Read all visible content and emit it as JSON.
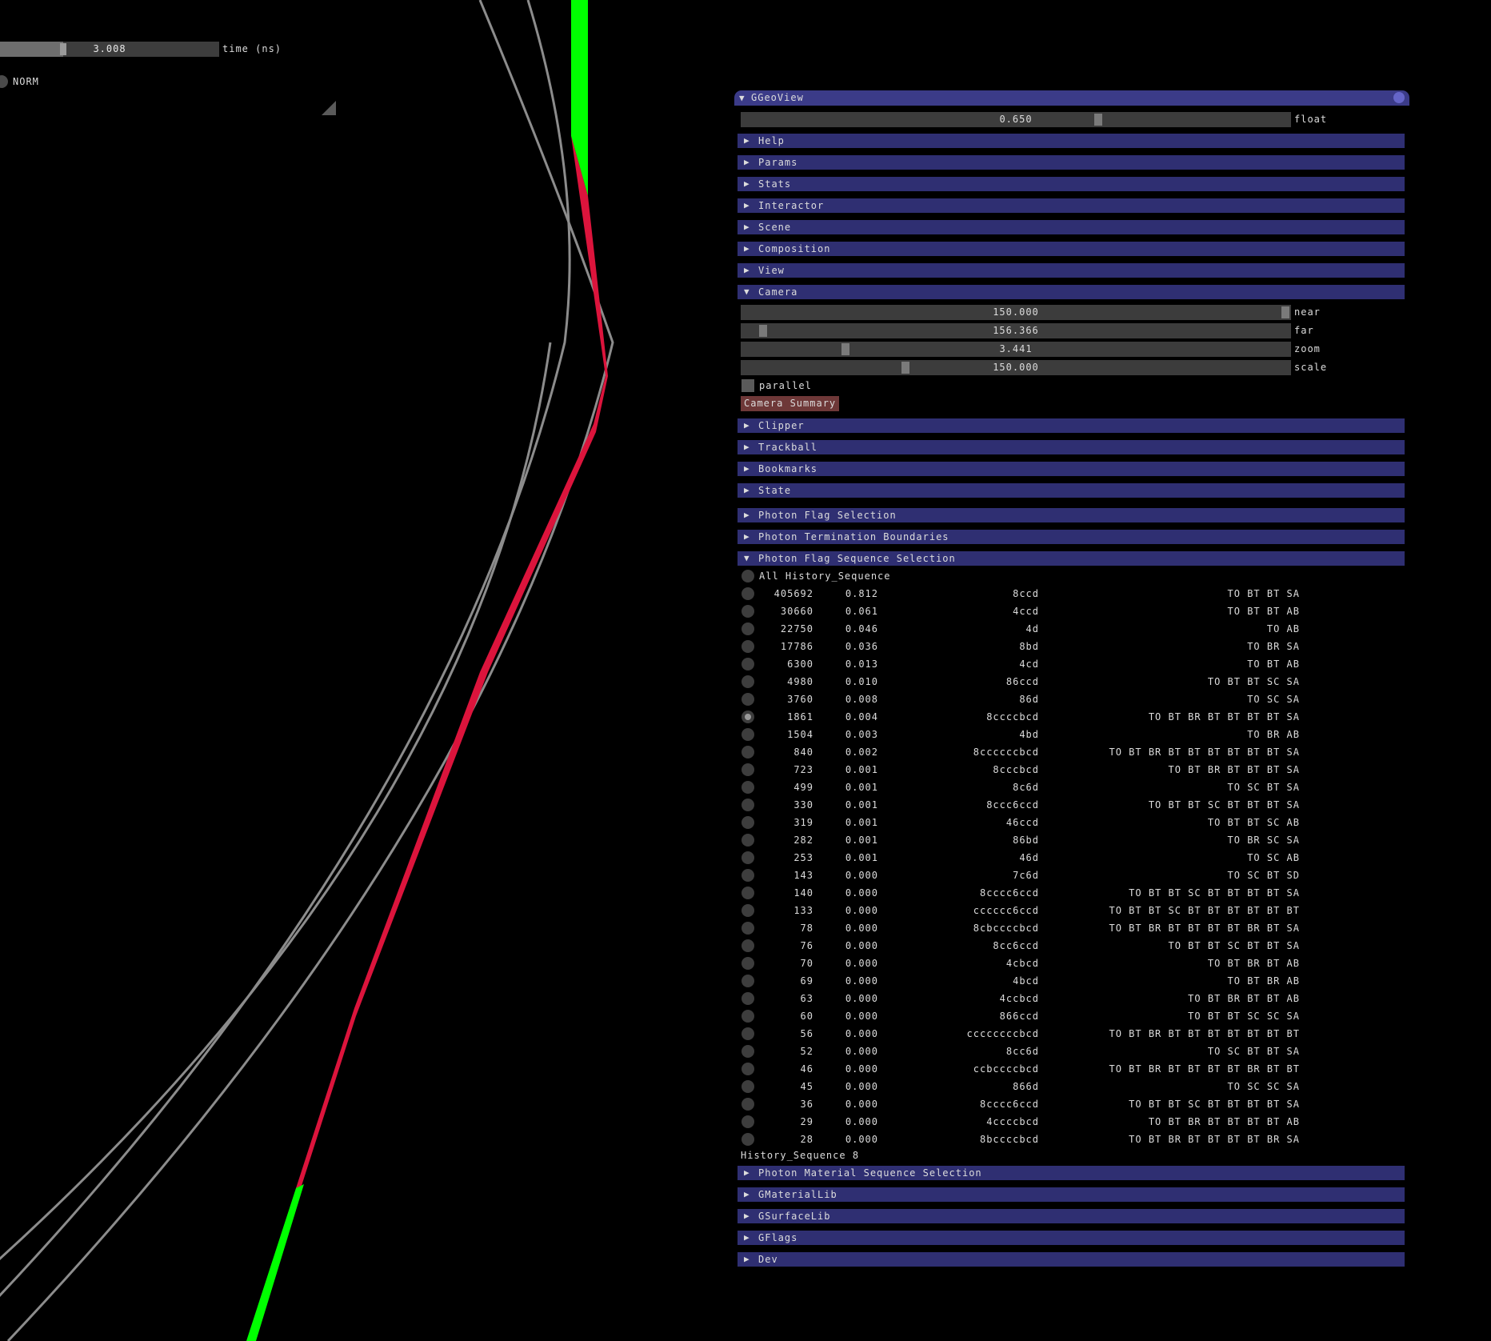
{
  "overlay": {
    "time_value": "3.008",
    "time_fraction": 0.29,
    "time_label": "time (ns)",
    "norm_label": "NORM"
  },
  "window": {
    "title": "GGeoView",
    "float_value": "0.650",
    "float_fraction": 0.65,
    "float_label": "float"
  },
  "sections_top": [
    "Help",
    "Params",
    "Stats",
    "Interactor",
    "Scene",
    "Composition",
    "View"
  ],
  "camera": {
    "header": "Camera",
    "sliders": [
      {
        "value": "150.000",
        "label": "near",
        "fraction": 0.99
      },
      {
        "value": "156.366",
        "label": "far",
        "fraction": 0.04
      },
      {
        "value": "3.441",
        "label": "zoom",
        "fraction": 0.19
      },
      {
        "value": "150.000",
        "label": "scale",
        "fraction": 0.3
      }
    ],
    "parallel_label": "parallel",
    "summary_button": "Camera Summary"
  },
  "sections_mid": [
    "Clipper",
    "Trackball",
    "Bookmarks",
    "State"
  ],
  "sections_flags": [
    "Photon Flag Selection",
    "Photon Termination Boundaries"
  ],
  "sequence": {
    "header": "Photon Flag Sequence Selection",
    "all_label": "All History_Sequence",
    "selected_index": 7,
    "rows": [
      [
        "405692",
        "0.812",
        "8ccd",
        "TO BT BT SA"
      ],
      [
        "30660",
        "0.061",
        "4ccd",
        "TO BT BT AB"
      ],
      [
        "22750",
        "0.046",
        "4d",
        "TO AB"
      ],
      [
        "17786",
        "0.036",
        "8bd",
        "TO BR SA"
      ],
      [
        "6300",
        "0.013",
        "4cd",
        "TO BT AB"
      ],
      [
        "4980",
        "0.010",
        "86ccd",
        "TO BT BT SC SA"
      ],
      [
        "3760",
        "0.008",
        "86d",
        "TO SC SA"
      ],
      [
        "1861",
        "0.004",
        "8ccccbcd",
        "TO BT BR BT BT BT BT SA"
      ],
      [
        "1504",
        "0.003",
        "4bd",
        "TO BR AB"
      ],
      [
        "840",
        "0.002",
        "8ccccccbcd",
        "TO BT BR BT BT BT BT BT BT SA"
      ],
      [
        "723",
        "0.001",
        "8cccbcd",
        "TO BT BR BT BT BT SA"
      ],
      [
        "499",
        "0.001",
        "8c6d",
        "TO SC BT SA"
      ],
      [
        "330",
        "0.001",
        "8ccc6ccd",
        "TO BT BT SC BT BT BT SA"
      ],
      [
        "319",
        "0.001",
        "46ccd",
        "TO BT BT SC AB"
      ],
      [
        "282",
        "0.001",
        "86bd",
        "TO BR SC SA"
      ],
      [
        "253",
        "0.001",
        "46d",
        "TO SC AB"
      ],
      [
        "143",
        "0.000",
        "7c6d",
        "TO SC BT SD"
      ],
      [
        "140",
        "0.000",
        "8cccc6ccd",
        "TO BT BT SC BT BT BT BT SA"
      ],
      [
        "133",
        "0.000",
        "cccccc6ccd",
        "TO BT BT SC BT BT BT BT BT BT"
      ],
      [
        "78",
        "0.000",
        "8cbccccbcd",
        "TO BT BR BT BT BT BT BR BT SA"
      ],
      [
        "76",
        "0.000",
        "8cc6ccd",
        "TO BT BT SC BT BT SA"
      ],
      [
        "70",
        "0.000",
        "4cbcd",
        "TO BT BR BT AB"
      ],
      [
        "69",
        "0.000",
        "4bcd",
        "TO BT BR AB"
      ],
      [
        "63",
        "0.000",
        "4ccbcd",
        "TO BT BR BT BT AB"
      ],
      [
        "60",
        "0.000",
        "866ccd",
        "TO BT BT SC SC SA"
      ],
      [
        "56",
        "0.000",
        "ccccccccbcd",
        "TO BT BR BT BT BT BT BT BT BT"
      ],
      [
        "52",
        "0.000",
        "8cc6d",
        "TO SC BT BT SA"
      ],
      [
        "46",
        "0.000",
        "ccbccccbcd",
        "TO BT BR BT BT BT BT BR BT BT"
      ],
      [
        "45",
        "0.000",
        "866d",
        "TO SC SC SA"
      ],
      [
        "36",
        "0.000",
        "8cccc6ccd",
        "TO BT BT SC BT BT BT BT SA"
      ],
      [
        "29",
        "0.000",
        "4ccccbcd",
        "TO BT BR BT BT BT BT AB"
      ],
      [
        "28",
        "0.000",
        "8bccccbcd",
        "TO BT BR BT BT BT BT BR SA"
      ]
    ],
    "footer": "History_Sequence 8"
  },
  "sections_bottom": [
    "Photon Material Sequence Selection",
    "GMaterialLib",
    "GSurfaceLib",
    "GFlags",
    "Dev"
  ],
  "colors": {
    "window_title": "#3b3b88",
    "section_header": "#2f2f72",
    "track_green": "#00ff00",
    "track_red": "#dc143c",
    "geometry_gray": "#8c8c8c"
  }
}
